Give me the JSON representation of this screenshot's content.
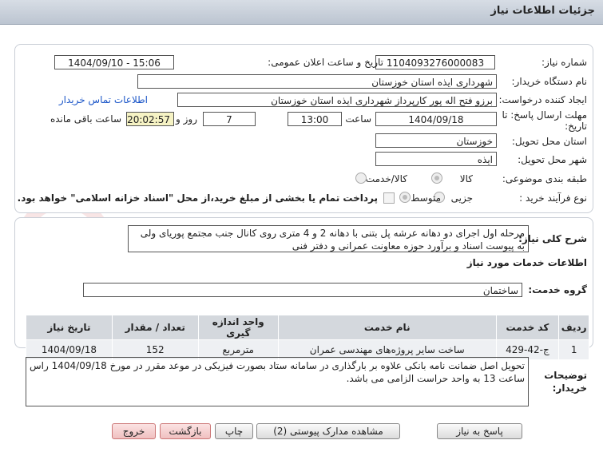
{
  "header": {
    "title": "جزئیات اطلاعات نیاز"
  },
  "form": {
    "need_number_label": "شماره نیاز:",
    "need_number": "1104093276000083",
    "announce_label": "تاریخ و ساعت اعلان عمومی:",
    "announce_value": "1404/09/10 - 15:06",
    "buyer_org_label": "نام دستگاه خریدار:",
    "buyer_org": "شهرداری ایذه استان خوزستان",
    "creator_label": "ایجاد کننده درخواست:",
    "creator": "برزو فتح اله پور کارپرداز شهرداری ایذه استان خوزستان",
    "contact_link": "اطلاعات تماس خریدار",
    "deadline_label_1": "مهلت ارسال پاسخ: تا",
    "deadline_label_2": "تاریخ:",
    "deadline_date": "1404/09/18",
    "time_label": "ساعت",
    "deadline_time": "13:00",
    "days": "7",
    "days_label": "روز و",
    "remaining_time": "20:02:57",
    "remaining_label": "ساعت باقی مانده",
    "province_label": "استان محل تحویل:",
    "province": "خوزستان",
    "city_label": "شهر محل تحویل:",
    "city": "ایذه",
    "category_label": "طبقه بندی موضوعی:",
    "category_goods": "کالا",
    "category_goods_service": "کالا/خدمت",
    "process_label": "نوع فرآیند خرید :",
    "process_partial": "جزیی",
    "process_medium": "متوسط",
    "payment_note": "پرداخت تمام یا بخشی از مبلغ خرید،از محل \"اسناد خزانه اسلامی\" خواهد بود."
  },
  "description": {
    "label": "شرح کلی نیاز:",
    "text": "مرحله اول اجرای دو دهانه عرشه پل بتنی با دهانه 2 و 4 متری روی کانال جنب مجتمع پوریای ولی به پیوست اسناد و برآورد حوزه معاونت عمرانی و دفتر فنی"
  },
  "services": {
    "section_title": "اطلاعات خدمات مورد نیاز",
    "group_label": "گروه خدمت:",
    "group_value": "ساختمان",
    "columns": [
      "ردیف",
      "کد خدمت",
      "نام خدمت",
      "واحد اندازه گیری",
      "تعداد / مقدار",
      "تاریخ نیاز"
    ],
    "rows": [
      [
        "1",
        "ج-42-429",
        "ساخت سایر پروژه‌های مهندسی عمران",
        "مترمربع",
        "152",
        "1404/09/18"
      ]
    ]
  },
  "notes": {
    "label_1": "توضیحات",
    "label_2": "خریدار:",
    "text": "تحویل اصل ضمانت نامه بانکی علاوه بر بارگذاری در سامانه ستاد بصورت فیزیکی در موعد مقرر در مورخ 1404/09/18 راس ساعت 13 به واحد حراست الزامی می باشد."
  },
  "buttons": {
    "reply": "پاسخ به نیاز",
    "attachments": "مشاهده مدارک پیوستی (2)",
    "print": "چاپ",
    "back": "بازگشت",
    "exit": "خروج"
  },
  "watermark": {
    "text": "AriaTender.net"
  }
}
